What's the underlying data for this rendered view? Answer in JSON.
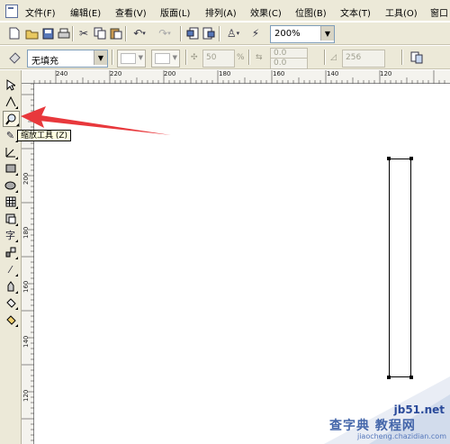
{
  "menu": {
    "items": [
      "文件(F)",
      "编辑(E)",
      "查看(V)",
      "版面(L)",
      "排列(A)",
      "效果(C)",
      "位图(B)",
      "文本(T)",
      "工具(O)",
      "窗口"
    ]
  },
  "toolbar": {
    "zoom_value": "200%"
  },
  "property_bar": {
    "fill_value": "无填充",
    "percent_value": "50",
    "percent_unit": "%",
    "offset_value_1": "0.0",
    "offset_value_2": "0.0",
    "angle_value": "256"
  },
  "rulers": {
    "horizontal_labels": [
      "240",
      "220",
      "200",
      "180",
      "160",
      "140",
      "120"
    ],
    "vertical_labels": [
      "200",
      "180",
      "160",
      "140",
      "120"
    ]
  },
  "tooltip": {
    "text": "缩放工具 (Z)"
  },
  "watermark": {
    "site": "jb51.net",
    "title": "查字典 教程网",
    "url": "jiaocheng.chazidian.com"
  },
  "colors": {
    "ui_bg": "#ece9d8",
    "tooltip_bg": "#ffffe1",
    "arrow": "#e8383c"
  },
  "icons": [
    "app-icon",
    "new-icon",
    "open-icon",
    "save-icon",
    "print-icon",
    "cut-icon",
    "copy-icon",
    "paste-icon",
    "undo-icon",
    "redo-icon",
    "import-icon",
    "export-icon",
    "launcher-icon",
    "snap-icon"
  ]
}
